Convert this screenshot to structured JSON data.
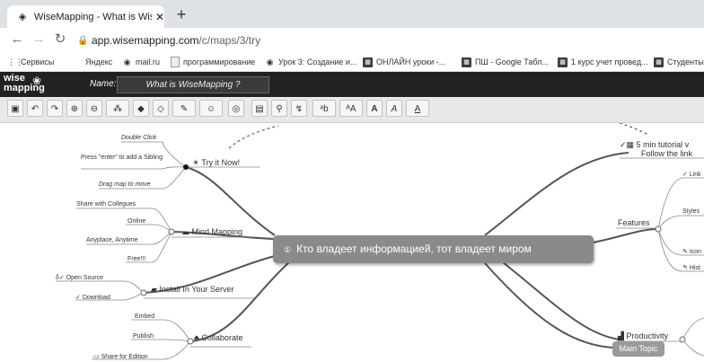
{
  "browser": {
    "tab_title": "WiseMapping - What is WiseMap",
    "url_host": "app.wisemapping.com",
    "url_path": "/c/maps/3/try",
    "bookmarks": [
      {
        "label": "Сервисы",
        "icon": "apps-icon"
      },
      {
        "label": "Яндекс",
        "icon": "yandex-icon"
      },
      {
        "label": "mail.ru",
        "icon": "globe-icon"
      },
      {
        "label": "программирование",
        "icon": "doc-icon"
      },
      {
        "label": "Урок 3: Создание и...",
        "icon": "globe-icon"
      },
      {
        "label": "ОНЛАЙН уроки -...",
        "icon": "sheet-icon"
      },
      {
        "label": "ПШ - Google Табл...",
        "icon": "sheet-icon"
      },
      {
        "label": "1 курс учет провед...",
        "icon": "sheet-icon"
      },
      {
        "label": "Студенты",
        "icon": "sheet-icon"
      }
    ]
  },
  "app": {
    "logo_line1": "wise",
    "logo_line2": "mapping",
    "name_label": "Name:",
    "map_name": "What is WiseMapping ?"
  },
  "mindmap": {
    "central": "Кто владеет информацией, тот владеет миром",
    "left_topics": {
      "try": "Try it Now!",
      "mind": "Mind Mapping",
      "install": "Install In Your Server",
      "collab": "Collaborate"
    },
    "try_children": [
      "Double Click",
      "Press \"enter\" to add a Sibling",
      "Drag map to move"
    ],
    "mind_children": [
      "Share with Collegues",
      "Online",
      "Anyplace, Anytime",
      "Free!!!"
    ],
    "install_children": [
      "Open Source",
      "Download"
    ],
    "collab_children": [
      "Embed",
      "Publish",
      "Share for Edition"
    ],
    "right_topics": {
      "tutorial_line1": "5 min tutorial v",
      "tutorial_line2": "Follow the link",
      "features": "Features",
      "productivity": "Productivity",
      "main_topic": "Main Topic"
    },
    "features_children": [
      "Link",
      "Styles",
      "Icon",
      "Hist"
    ]
  }
}
